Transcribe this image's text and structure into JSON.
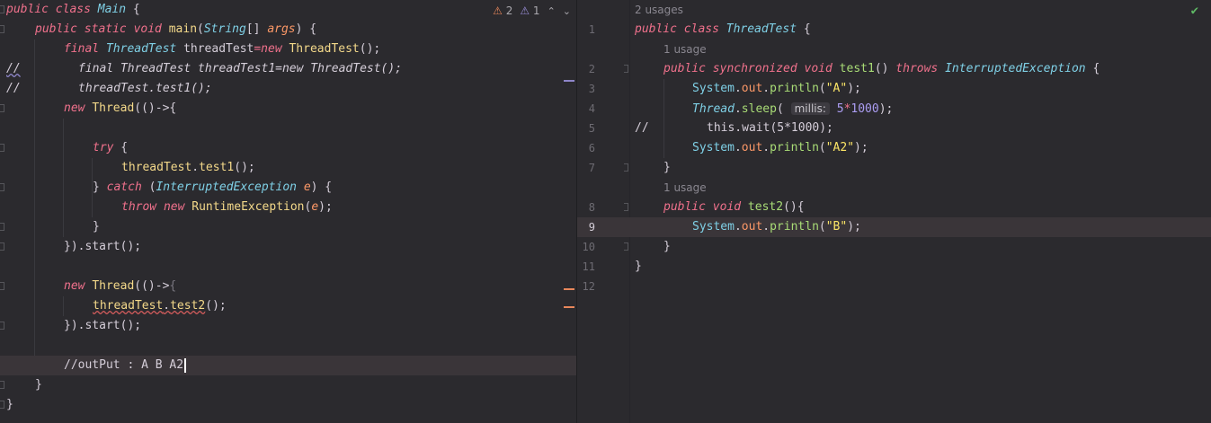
{
  "left_editor": {
    "inspection": {
      "warnings": "2",
      "weak_warnings": "1"
    },
    "lines": {
      "l1": [
        "public class ",
        "Main",
        " {"
      ],
      "l2": [
        "public static void ",
        "main",
        "(",
        "String",
        "[] ",
        "args",
        ") {"
      ],
      "l3": [
        "final ",
        "ThreadTest",
        " threadTest",
        "=",
        "new ",
        "ThreadTest",
        "();"
      ],
      "l4_prefix": "//",
      "l4": "final ThreadTest threadTest1=new ThreadTest();",
      "l5_prefix": "//",
      "l5": "threadTest.test1();",
      "l6": [
        "new ",
        "Thread",
        "(()->{"
      ],
      "l8": [
        "try",
        " {"
      ],
      "l9": [
        "threadTest",
        ".",
        "test1",
        "();"
      ],
      "l10": [
        "} ",
        "catch",
        " (",
        "InterruptedException",
        " ",
        "e",
        ") {"
      ],
      "l11": [
        "throw ",
        "new ",
        "RuntimeException",
        "(",
        "e",
        ");"
      ],
      "l12": "}",
      "l13": "}).start();",
      "l15": [
        "new ",
        "Thread",
        "(()->",
        "{"
      ],
      "l16": [
        "threadTest",
        ".",
        "test2",
        "();"
      ],
      "l17": "}).start();",
      "l19": "//outPut : A B A2",
      "l20": "}",
      "l21": "}"
    }
  },
  "right_editor": {
    "line_numbers": [
      "1",
      "2",
      "3",
      "4",
      "5",
      "6",
      "7",
      "8",
      "9",
      "10",
      "11",
      "12"
    ],
    "usages": {
      "class": "2 usages",
      "test1": "1 usage",
      "test2": "1 usage"
    },
    "lines": {
      "r1": [
        "public class ",
        "ThreadTest",
        " {"
      ],
      "r2": [
        "public synchronized void ",
        "test1",
        "() ",
        "throws ",
        "InterruptedException",
        " {"
      ],
      "r3": [
        "System",
        ".",
        "out",
        ".",
        "println",
        "(",
        "\"A\"",
        ");"
      ],
      "r4": [
        "Thread",
        ".",
        "sleep",
        "( ",
        "millis:",
        " ",
        "5",
        "*",
        "1000",
        ");"
      ],
      "r5_prefix": "//",
      "r5": "this.wait(5*1000);",
      "r6": [
        "System",
        ".",
        "out",
        ".",
        "println",
        "(",
        "\"A2\"",
        ");"
      ],
      "r7": "}",
      "r8": [
        "public void ",
        "test2",
        "(){"
      ],
      "r9": [
        "System",
        ".",
        "out",
        ".",
        "println",
        "(",
        "\"B\"",
        ");"
      ],
      "r10": "}",
      "r11": "}"
    }
  },
  "colors": {
    "keyword": "#f0718c",
    "class": "#7fd0e6",
    "method": "#f4d98a",
    "string": "#fce566",
    "number": "#ab9df2",
    "background": "#2b2a2e"
  }
}
